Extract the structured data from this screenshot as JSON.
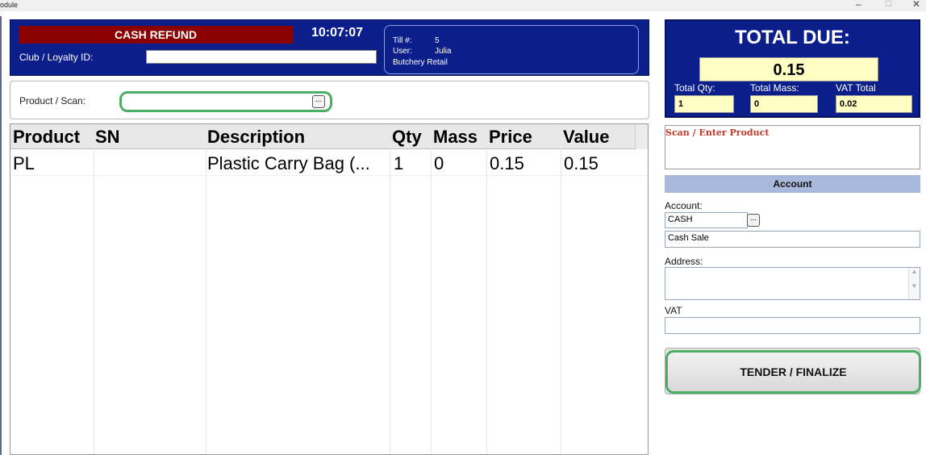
{
  "window": {
    "title": "odule",
    "min_glyph": "–",
    "max_glyph": "☐",
    "close_glyph": "✕"
  },
  "header": {
    "mode_label": "CASH REFUND",
    "time": "10:07:07",
    "loyalty_label": "Club / Loyalty ID:",
    "loyalty_value": "",
    "till_label": "Till #:",
    "till_value": "5",
    "user_label": "User:",
    "user_value": "Julia",
    "store": "Butchery Retail"
  },
  "scan": {
    "label": "Product / Scan:",
    "value": "",
    "lookup_button": "..."
  },
  "grid": {
    "columns": [
      "Product",
      "SN",
      "Description",
      "Qty",
      "Mass",
      "Price",
      "Value"
    ],
    "rows": [
      [
        "PL",
        "",
        "Plastic Carry Bag (...",
        "1",
        "0",
        "0.15",
        "0.15"
      ]
    ]
  },
  "totals": {
    "title": "TOTAL DUE:",
    "amount": "0.15",
    "qty_label": "Total Qty:",
    "qty_value": "1",
    "mass_label": "Total Mass:",
    "mass_value": "0",
    "vat_label": "VAT Total",
    "vat_value": "0.02"
  },
  "scan_prompt": "Scan / Enter Product",
  "account": {
    "section_title": "Account",
    "account_label": "Account:",
    "account_code": "CASH",
    "lookup_button": "...",
    "account_name": "Cash Sale",
    "address_label": "Address:",
    "address_value": "",
    "vat_label": "VAT",
    "vat_value": ""
  },
  "actions": {
    "tender_label": "TENDER / FINALIZE"
  }
}
